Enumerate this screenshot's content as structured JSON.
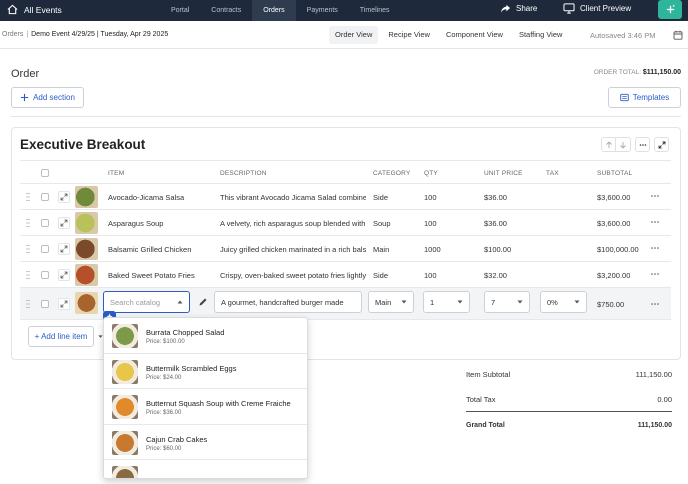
{
  "nav": {
    "brand": "All Events",
    "tabs": [
      {
        "label": "Portal"
      },
      {
        "label": "Contracts"
      },
      {
        "label": "Orders",
        "active": true
      },
      {
        "label": "Payments"
      },
      {
        "label": "Timelines"
      }
    ],
    "share_label": "Share",
    "preview_label": "Client Preview"
  },
  "subheader": {
    "breadcrumb_root": "Orders",
    "breadcrumb_current": "Demo Event 4/29/25 | Tuesday, Apr 29 2025",
    "views": [
      {
        "label": "Order View",
        "active": true
      },
      {
        "label": "Recipe View"
      },
      {
        "label": "Component View"
      },
      {
        "label": "Staffing View"
      }
    ],
    "autosave": "Autosaved 3:46 PM"
  },
  "order": {
    "title": "Order",
    "total_label": "ORDER TOTAL:",
    "total_value": "$111,150.00",
    "add_section_label": "Add section",
    "templates_label": "Templates"
  },
  "section": {
    "title": "Executive Breakout",
    "columns": {
      "item": "ITEM",
      "description": "DESCRIPTION",
      "category": "CATEGORY",
      "qty": "QTY",
      "unit_price": "UNIT PRICE",
      "tax": "TAX",
      "subtotal": "SUBTOTAL"
    },
    "rows": [
      {
        "item": "Avocado-Jicama Salsa",
        "description": "This vibrant Avocado Jicama Salad combines",
        "category": "Side",
        "qty": "100",
        "unit_price": "$36.00",
        "tax": "",
        "subtotal": "$3,600.00",
        "thumb": "#6f8a3a"
      },
      {
        "item": "Asparagus Soup",
        "description": "A velvety, rich asparagus soup blended with",
        "category": "Soup",
        "qty": "100",
        "unit_price": "$36.00",
        "tax": "",
        "subtotal": "$3,600.00",
        "thumb": "#b9c25a"
      },
      {
        "item": "Balsamic Grilled Chicken",
        "description": "Juicy grilled chicken marinated in a rich balsamic",
        "category": "Main",
        "qty": "1000",
        "unit_price": "$100.00",
        "tax": "",
        "subtotal": "$100,000.00",
        "thumb": "#7a4a2a"
      },
      {
        "item": "Baked Sweet Potato Fries",
        "description": "Crispy, oven-baked sweet potato fries lightly",
        "category": "Side",
        "qty": "100",
        "unit_price": "$32.00",
        "tax": "",
        "subtotal": "$3,200.00",
        "thumb": "#b5502a"
      }
    ],
    "editing_row": {
      "search_placeholder": "Search catalog",
      "description": "A gourmet, handcrafted burger made",
      "category": "Main",
      "qty": "1",
      "unit_price": "7",
      "tax": "0%",
      "subtotal": "$750.00",
      "thumb": "#a8642c"
    },
    "add_line_label": "Add line item"
  },
  "totals": {
    "item_subtotal_label": "Item Subtotal",
    "item_subtotal_value": "111,150.00",
    "total_tax_label": "Total Tax",
    "total_tax_value": "0.00",
    "grand_total_label": "Grand Total",
    "grand_total_value": "111,150.00"
  },
  "catalog_dropdown": {
    "items": [
      {
        "name": "Burrata Chopped Salad",
        "price": "Price: $100.00",
        "thumb": "#7d9a4b"
      },
      {
        "name": "Buttermilk Scrambled Eggs",
        "price": "Price: $24.00",
        "thumb": "#e7c64a"
      },
      {
        "name": "Butternut Squash Soup with Creme Fraiche",
        "price": "Price: $36.00",
        "thumb": "#e08a2a"
      },
      {
        "name": "Cajun Crab Cakes",
        "price": "Price: $60.00",
        "thumb": "#c9782f"
      },
      {
        "name": "",
        "price": "",
        "thumb": "#8a6a40"
      }
    ]
  },
  "colors": {
    "nav_bg": "#1e2a3b",
    "accent": "#2a5cc8",
    "add_button": "#2fb59b"
  }
}
